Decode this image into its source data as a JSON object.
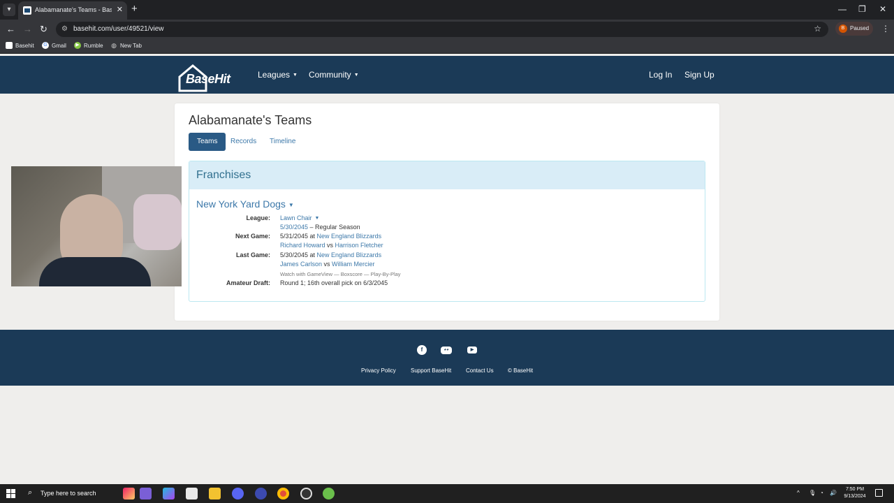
{
  "browser": {
    "tab_title": "Alabamanate's Teams - BaseHit",
    "url": "basehit.com/user/49521/view",
    "profile_label": "Paused",
    "profile_initial": "B",
    "bookmarks": [
      "Basehit",
      "Gmail",
      "Rumble",
      "New Tab"
    ]
  },
  "site": {
    "logo": "BaseHit",
    "nav": {
      "leagues": "Leagues",
      "community": "Community",
      "login": "Log In",
      "signup": "Sign Up"
    }
  },
  "page": {
    "title": "Alabamanate's Teams",
    "tabs": [
      "Teams",
      "Records",
      "Timeline"
    ],
    "panel_title": "Franchises",
    "team_name": "New York Yard Dogs",
    "league_label": "League:",
    "league_value": "Lawn Chair",
    "league_date": "5/30/2045",
    "league_phase": " – Regular Season",
    "next_label": "Next Game:",
    "next_date": "5/31/2045 at ",
    "next_opponent": "New England Blizzards",
    "next_p1": "Richard Howard",
    "vs": " vs ",
    "next_p2": "Harrison Fletcher",
    "last_label": "Last Game:",
    "last_date": "5/30/2045 at ",
    "last_opponent": "New England Blizzards",
    "last_p1": "James Carlson",
    "last_p2": "William Mercier",
    "watch_links": "Watch with GameView — Boxscore — Play-By-Play",
    "draft_label": "Amateur Draft:",
    "draft_value": "Round 1; 16th overall pick on 6/3/2045"
  },
  "footer": {
    "links": [
      "Privacy Policy",
      "Support BaseHit",
      "Contact Us",
      "© BaseHit"
    ]
  },
  "taskbar": {
    "search_placeholder": "Type here to search",
    "time": "7:50 PM",
    "date": "9/13/2024"
  }
}
